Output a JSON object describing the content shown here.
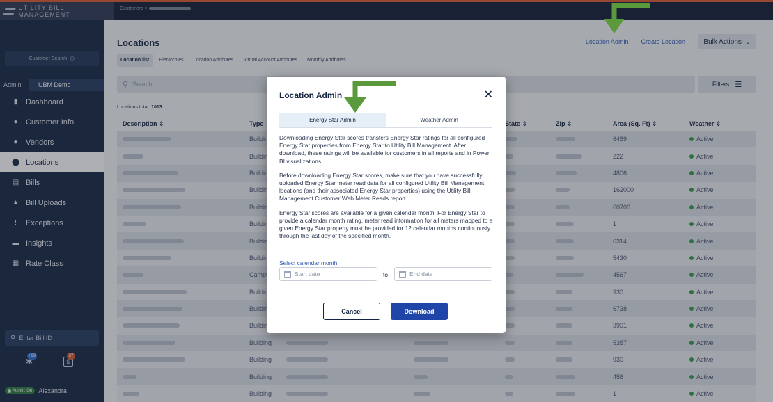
{
  "app": {
    "brand": "UTILITY BILL MANAGEMENT",
    "breadcrumb": "Customers >"
  },
  "sidebar": {
    "customer_search": "Customer Search",
    "admin_label": "Admin",
    "customer_name": "UBM Demo",
    "items": [
      {
        "label": "Dashboard",
        "icon": "dashboard-icon",
        "glyph": "▮"
      },
      {
        "label": "Customer Info",
        "icon": "person-icon",
        "glyph": "●"
      },
      {
        "label": "Vendors",
        "icon": "person-icon",
        "glyph": "●"
      },
      {
        "label": "Locations",
        "icon": "location-pin-icon",
        "glyph": "⬤"
      },
      {
        "label": "Bills",
        "icon": "document-icon",
        "glyph": "▤"
      },
      {
        "label": "Bill Uploads",
        "icon": "upload-icon",
        "glyph": "▲"
      },
      {
        "label": "Exceptions",
        "icon": "alert-icon",
        "glyph": "!"
      },
      {
        "label": "Insights",
        "icon": "chat-icon",
        "glyph": "▬"
      },
      {
        "label": "Rate Class",
        "icon": "table-icon",
        "glyph": "▦"
      }
    ],
    "active_index": 3,
    "bill_id_placeholder": "Enter Bill ID",
    "badge_notifications": "+99",
    "badge_bills": "37",
    "admin_toggle": "Admin: On",
    "user_name": "Alexandra"
  },
  "main": {
    "title": "Locations",
    "link_location_admin": "Location Admin",
    "link_create_location": "Create Location",
    "bulk_actions": "Bulk Actions",
    "tabs": [
      "Location list",
      "Hierarchies",
      "Location Attributes",
      "Virtual Account Attributes",
      "Monthly Attributes"
    ],
    "search_placeholder": "Search",
    "filters": "Filters",
    "total_label": "Locations total:",
    "total_value": "1013",
    "columns": [
      "Description ⇕",
      "Type ⇕",
      "",
      "",
      "State ⇕",
      "Zip ⇕",
      "Area (Sq. Ft) ⇕",
      "Weather ⇕"
    ],
    "rows": [
      {
        "type": "Buildin",
        "area": "6489",
        "weather": "Active"
      },
      {
        "type": "Buildin",
        "area": "222",
        "weather": "Active"
      },
      {
        "type": "Buildin",
        "area": "4806",
        "weather": "Active"
      },
      {
        "type": "Buildin",
        "area": "162000",
        "weather": "Active"
      },
      {
        "type": "Buildin",
        "area": "60700",
        "weather": "Active"
      },
      {
        "type": "Buildin",
        "area": "1",
        "weather": "Active"
      },
      {
        "type": "Buildin",
        "area": "6314",
        "weather": "Active"
      },
      {
        "type": "Buildin",
        "area": "5430",
        "weather": "Active"
      },
      {
        "type": "Campu",
        "area": "4567",
        "weather": "Active"
      },
      {
        "type": "Buildin",
        "area": "930",
        "weather": "Active"
      },
      {
        "type": "Buildin",
        "area": "6738",
        "weather": "Active"
      },
      {
        "type": "Buildin",
        "area": "3901",
        "weather": "Active"
      },
      {
        "type": "Building",
        "area": "5387",
        "weather": "Active"
      },
      {
        "type": "Building",
        "area": "930",
        "weather": "Active"
      },
      {
        "type": "Building",
        "area": "456",
        "weather": "Active"
      },
      {
        "type": "Building",
        "area": "1",
        "weather": "Active"
      }
    ]
  },
  "modal": {
    "title": "Location Admin",
    "tab_energy_star": "Energy Star Admin",
    "tab_weather": "Weather Admin",
    "para1": "Downloading Energy Star scores transfers Energy Star ratings for all configured Energy Star properties from Energy Star to Utility Bill Management. After download, these ratings will be available for customers in all reports and in Power BI visualizations.",
    "para2": "Before downloading Energy Star scores, make sure that you have successfully uploaded Energy Star meter read data for all configured Utility Bill Management locations (and their associated Energy Star properties) using the Utility Bill Management Customer Web Meter Reads report.",
    "para3": "Energy Star scores are available for a given calendar month. For Energy Star to provide a calendar month rating, meter read information for all meters mapped to a given Energy Star property must be provided for 12 calendar months continuously through the last day of the specified month.",
    "month_label": "Select calendar month",
    "start_placeholder": "Start date",
    "to": "to",
    "end_placeholder": "End date",
    "cancel": "Cancel",
    "download": "Download"
  },
  "colors": {
    "sidebar": "#142440",
    "accent": "#1f45a8",
    "arrow": "#5b9a3c",
    "active": "#2f9a46"
  }
}
